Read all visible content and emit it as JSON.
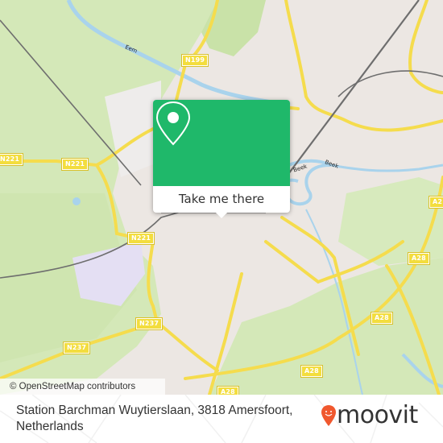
{
  "map": {
    "attribution": "© OpenStreetMap contributors",
    "road_labels": [
      "N221",
      "N221",
      "N221",
      "N199",
      "N237",
      "N237",
      "A28",
      "A28",
      "A28",
      "A28",
      "A2"
    ],
    "water_labels": [
      "Eem",
      "Beek",
      "Beek"
    ],
    "colors": {
      "urban": "#ece7e3",
      "green": "#d4e8b8",
      "dark_green": "#c3de9f",
      "water": "#a9d3ec",
      "road": "#f5dc4d",
      "rail": "#6e6e6e",
      "industrial": "#e4dff3"
    }
  },
  "popup": {
    "icon": "location-pin-icon",
    "button_label": "Take me there",
    "color": "#1fb86a"
  },
  "footer": {
    "address": "Station Barchman Wuytierslaan, 3818 Amersfoort, Netherlands",
    "brand": "moovit",
    "brand_color": "#f0582e"
  }
}
